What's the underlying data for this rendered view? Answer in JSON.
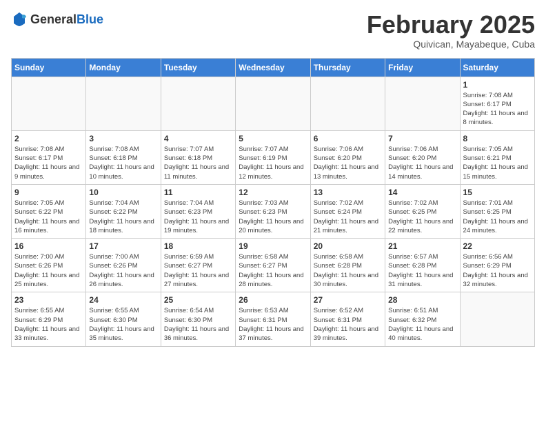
{
  "logo": {
    "text_general": "General",
    "text_blue": "Blue"
  },
  "title": {
    "month": "February 2025",
    "location": "Quivican, Mayabeque, Cuba"
  },
  "days_of_week": [
    "Sunday",
    "Monday",
    "Tuesday",
    "Wednesday",
    "Thursday",
    "Friday",
    "Saturday"
  ],
  "weeks": [
    [
      {
        "day": "",
        "info": ""
      },
      {
        "day": "",
        "info": ""
      },
      {
        "day": "",
        "info": ""
      },
      {
        "day": "",
        "info": ""
      },
      {
        "day": "",
        "info": ""
      },
      {
        "day": "",
        "info": ""
      },
      {
        "day": "1",
        "info": "Sunrise: 7:08 AM\nSunset: 6:17 PM\nDaylight: 11 hours and 8 minutes."
      }
    ],
    [
      {
        "day": "2",
        "info": "Sunrise: 7:08 AM\nSunset: 6:17 PM\nDaylight: 11 hours and 9 minutes."
      },
      {
        "day": "3",
        "info": "Sunrise: 7:08 AM\nSunset: 6:18 PM\nDaylight: 11 hours and 10 minutes."
      },
      {
        "day": "4",
        "info": "Sunrise: 7:07 AM\nSunset: 6:18 PM\nDaylight: 11 hours and 11 minutes."
      },
      {
        "day": "5",
        "info": "Sunrise: 7:07 AM\nSunset: 6:19 PM\nDaylight: 11 hours and 12 minutes."
      },
      {
        "day": "6",
        "info": "Sunrise: 7:06 AM\nSunset: 6:20 PM\nDaylight: 11 hours and 13 minutes."
      },
      {
        "day": "7",
        "info": "Sunrise: 7:06 AM\nSunset: 6:20 PM\nDaylight: 11 hours and 14 minutes."
      },
      {
        "day": "8",
        "info": "Sunrise: 7:05 AM\nSunset: 6:21 PM\nDaylight: 11 hours and 15 minutes."
      }
    ],
    [
      {
        "day": "9",
        "info": "Sunrise: 7:05 AM\nSunset: 6:22 PM\nDaylight: 11 hours and 16 minutes."
      },
      {
        "day": "10",
        "info": "Sunrise: 7:04 AM\nSunset: 6:22 PM\nDaylight: 11 hours and 18 minutes."
      },
      {
        "day": "11",
        "info": "Sunrise: 7:04 AM\nSunset: 6:23 PM\nDaylight: 11 hours and 19 minutes."
      },
      {
        "day": "12",
        "info": "Sunrise: 7:03 AM\nSunset: 6:23 PM\nDaylight: 11 hours and 20 minutes."
      },
      {
        "day": "13",
        "info": "Sunrise: 7:02 AM\nSunset: 6:24 PM\nDaylight: 11 hours and 21 minutes."
      },
      {
        "day": "14",
        "info": "Sunrise: 7:02 AM\nSunset: 6:25 PM\nDaylight: 11 hours and 22 minutes."
      },
      {
        "day": "15",
        "info": "Sunrise: 7:01 AM\nSunset: 6:25 PM\nDaylight: 11 hours and 24 minutes."
      }
    ],
    [
      {
        "day": "16",
        "info": "Sunrise: 7:00 AM\nSunset: 6:26 PM\nDaylight: 11 hours and 25 minutes."
      },
      {
        "day": "17",
        "info": "Sunrise: 7:00 AM\nSunset: 6:26 PM\nDaylight: 11 hours and 26 minutes."
      },
      {
        "day": "18",
        "info": "Sunrise: 6:59 AM\nSunset: 6:27 PM\nDaylight: 11 hours and 27 minutes."
      },
      {
        "day": "19",
        "info": "Sunrise: 6:58 AM\nSunset: 6:27 PM\nDaylight: 11 hours and 28 minutes."
      },
      {
        "day": "20",
        "info": "Sunrise: 6:58 AM\nSunset: 6:28 PM\nDaylight: 11 hours and 30 minutes."
      },
      {
        "day": "21",
        "info": "Sunrise: 6:57 AM\nSunset: 6:28 PM\nDaylight: 11 hours and 31 minutes."
      },
      {
        "day": "22",
        "info": "Sunrise: 6:56 AM\nSunset: 6:29 PM\nDaylight: 11 hours and 32 minutes."
      }
    ],
    [
      {
        "day": "23",
        "info": "Sunrise: 6:55 AM\nSunset: 6:29 PM\nDaylight: 11 hours and 33 minutes."
      },
      {
        "day": "24",
        "info": "Sunrise: 6:55 AM\nSunset: 6:30 PM\nDaylight: 11 hours and 35 minutes."
      },
      {
        "day": "25",
        "info": "Sunrise: 6:54 AM\nSunset: 6:30 PM\nDaylight: 11 hours and 36 minutes."
      },
      {
        "day": "26",
        "info": "Sunrise: 6:53 AM\nSunset: 6:31 PM\nDaylight: 11 hours and 37 minutes."
      },
      {
        "day": "27",
        "info": "Sunrise: 6:52 AM\nSunset: 6:31 PM\nDaylight: 11 hours and 39 minutes."
      },
      {
        "day": "28",
        "info": "Sunrise: 6:51 AM\nSunset: 6:32 PM\nDaylight: 11 hours and 40 minutes."
      },
      {
        "day": "",
        "info": ""
      }
    ]
  ]
}
